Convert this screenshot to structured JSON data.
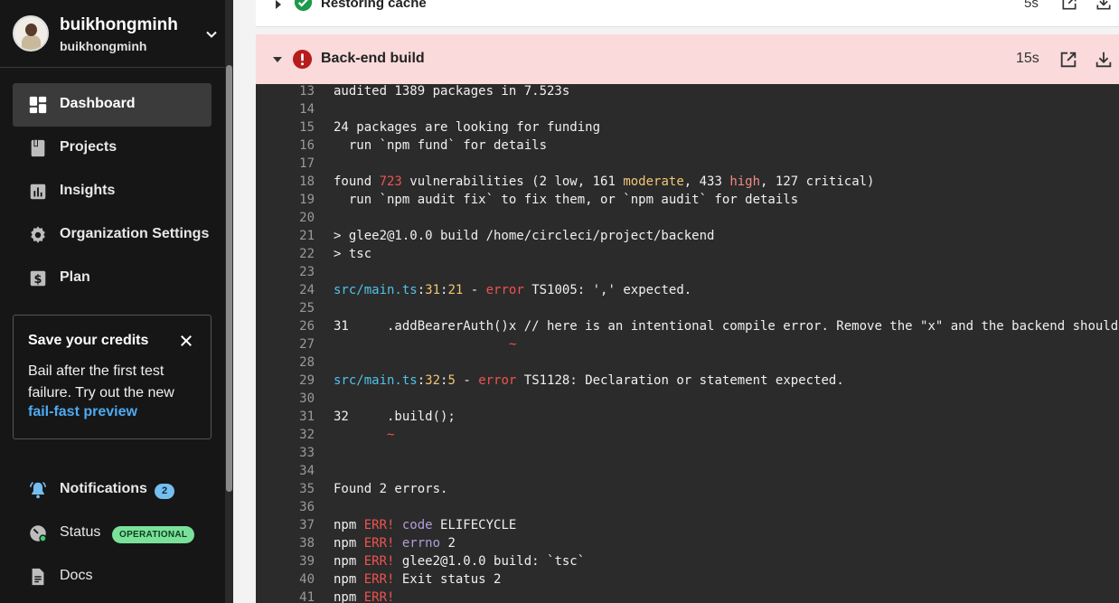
{
  "account": {
    "name": "buikhongminh",
    "org": "buikhongminh"
  },
  "nav": {
    "dashboard": "Dashboard",
    "projects": "Projects",
    "insights": "Insights",
    "org_settings": "Organization Settings",
    "plan": "Plan"
  },
  "credits_card": {
    "title": "Save your credits",
    "body": "Bail after the first test failure. Try out the new",
    "link": "fail-fast preview"
  },
  "bottom_nav": {
    "notifications": "Notifications",
    "notifications_count": "2",
    "status": "Status",
    "status_badge": "OPERATIONAL",
    "docs": "Docs"
  },
  "steps": {
    "prev": {
      "title": "Restoring cache",
      "duration": "5s"
    },
    "current": {
      "title": "Back-end build",
      "duration": "15s"
    }
  },
  "log_lines": [
    {
      "n": "13",
      "segs": [
        [
          "audited 1389 packages in 7.523s",
          ""
        ]
      ]
    },
    {
      "n": "14",
      "segs": []
    },
    {
      "n": "15",
      "segs": [
        [
          "24 packages are looking for funding",
          ""
        ]
      ]
    },
    {
      "n": "16",
      "segs": [
        [
          "  run `npm fund` for details",
          ""
        ]
      ]
    },
    {
      "n": "17",
      "segs": []
    },
    {
      "n": "18",
      "segs": [
        [
          "found ",
          ""
        ],
        [
          "723",
          "c-red"
        ],
        [
          " vulnerabilities (2 low, 161 ",
          ""
        ],
        [
          "moderate",
          "c-yellow"
        ],
        [
          ", 433 ",
          ""
        ],
        [
          "high",
          "c-redlight"
        ],
        [
          ", 127 critical)",
          ""
        ]
      ]
    },
    {
      "n": "19",
      "segs": [
        [
          "  run `npm audit fix` to fix them, or `npm audit` for details",
          ""
        ]
      ]
    },
    {
      "n": "20",
      "segs": []
    },
    {
      "n": "21",
      "segs": [
        [
          "> glee2@1.0.0 build /home/circleci/project/backend",
          ""
        ]
      ]
    },
    {
      "n": "22",
      "segs": [
        [
          "> tsc",
          ""
        ]
      ]
    },
    {
      "n": "23",
      "segs": []
    },
    {
      "n": "24",
      "segs": [
        [
          "src/main.ts",
          "c-cyan"
        ],
        [
          ":",
          ""
        ],
        [
          "31",
          "c-yellow"
        ],
        [
          ":",
          ""
        ],
        [
          "21",
          "c-yellow"
        ],
        [
          " - ",
          ""
        ],
        [
          "error",
          "c-red"
        ],
        [
          " TS1005: ',' expected.",
          ""
        ]
      ]
    },
    {
      "n": "25",
      "segs": []
    },
    {
      "n": "26",
      "segs": [
        [
          "31     .addBearerAuth()x // here is an intentional compile error. Remove the \"x\" and the backend should",
          ""
        ]
      ]
    },
    {
      "n": "27",
      "segs": [
        [
          "                       ~",
          "c-red"
        ]
      ]
    },
    {
      "n": "28",
      "segs": []
    },
    {
      "n": "29",
      "segs": [
        [
          "src/main.ts",
          "c-cyan"
        ],
        [
          ":",
          ""
        ],
        [
          "32",
          "c-yellow"
        ],
        [
          ":",
          ""
        ],
        [
          "5",
          "c-yellow"
        ],
        [
          " - ",
          ""
        ],
        [
          "error",
          "c-red"
        ],
        [
          " TS1128: Declaration or statement expected.",
          ""
        ]
      ]
    },
    {
      "n": "30",
      "segs": []
    },
    {
      "n": "31",
      "segs": [
        [
          "32     .build();",
          ""
        ]
      ]
    },
    {
      "n": "32",
      "segs": [
        [
          "       ~",
          "c-red"
        ]
      ]
    },
    {
      "n": "33",
      "segs": []
    },
    {
      "n": "34",
      "segs": []
    },
    {
      "n": "35",
      "segs": [
        [
          "Found 2 errors.",
          ""
        ]
      ]
    },
    {
      "n": "36",
      "segs": []
    },
    {
      "n": "37",
      "segs": [
        [
          "npm ",
          ""
        ],
        [
          "ERR!",
          "c-red"
        ],
        [
          " ",
          ""
        ],
        [
          "code",
          "c-purple"
        ],
        [
          " ELIFECYCLE",
          ""
        ]
      ]
    },
    {
      "n": "38",
      "segs": [
        [
          "npm ",
          ""
        ],
        [
          "ERR!",
          "c-red"
        ],
        [
          " ",
          ""
        ],
        [
          "errno",
          "c-purple"
        ],
        [
          " 2",
          ""
        ]
      ]
    },
    {
      "n": "39",
      "segs": [
        [
          "npm ",
          ""
        ],
        [
          "ERR!",
          "c-red"
        ],
        [
          " glee2@1.0.0 build: `tsc`",
          ""
        ]
      ]
    },
    {
      "n": "40",
      "segs": [
        [
          "npm ",
          ""
        ],
        [
          "ERR!",
          "c-red"
        ],
        [
          " Exit status 2",
          ""
        ]
      ]
    },
    {
      "n": "41",
      "segs": [
        [
          "npm ",
          ""
        ],
        [
          "ERR!",
          "c-red"
        ]
      ]
    }
  ]
}
